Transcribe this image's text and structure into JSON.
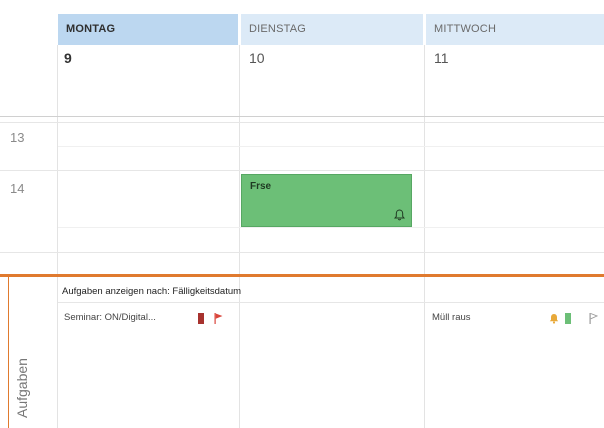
{
  "header": {
    "days": [
      {
        "label": "MONTAG",
        "num": "9"
      },
      {
        "label": "DIENSTAG",
        "num": "10"
      },
      {
        "label": "MITTWOCH",
        "num": "11"
      }
    ]
  },
  "times": [
    "13",
    "14"
  ],
  "event": {
    "title": "Frse",
    "icon": "bell-icon"
  },
  "tasks": {
    "section_label": "Aufgaben",
    "header": "Aufgaben anzeigen nach: Fälligkeitsdatum",
    "items": [
      {
        "text": "Seminar: ON/Digital...",
        "color": "#a7322e",
        "flag_color": "#d9453b"
      },
      {
        "text": "Müll raus",
        "bell_color": "#e8a93a",
        "square_color": "#6cbf77"
      }
    ]
  },
  "colors": {
    "today_header": "#bcd7f0",
    "header": "#dceaf7",
    "event": "#6cbf77",
    "tasks_accent": "#e07a2e"
  }
}
